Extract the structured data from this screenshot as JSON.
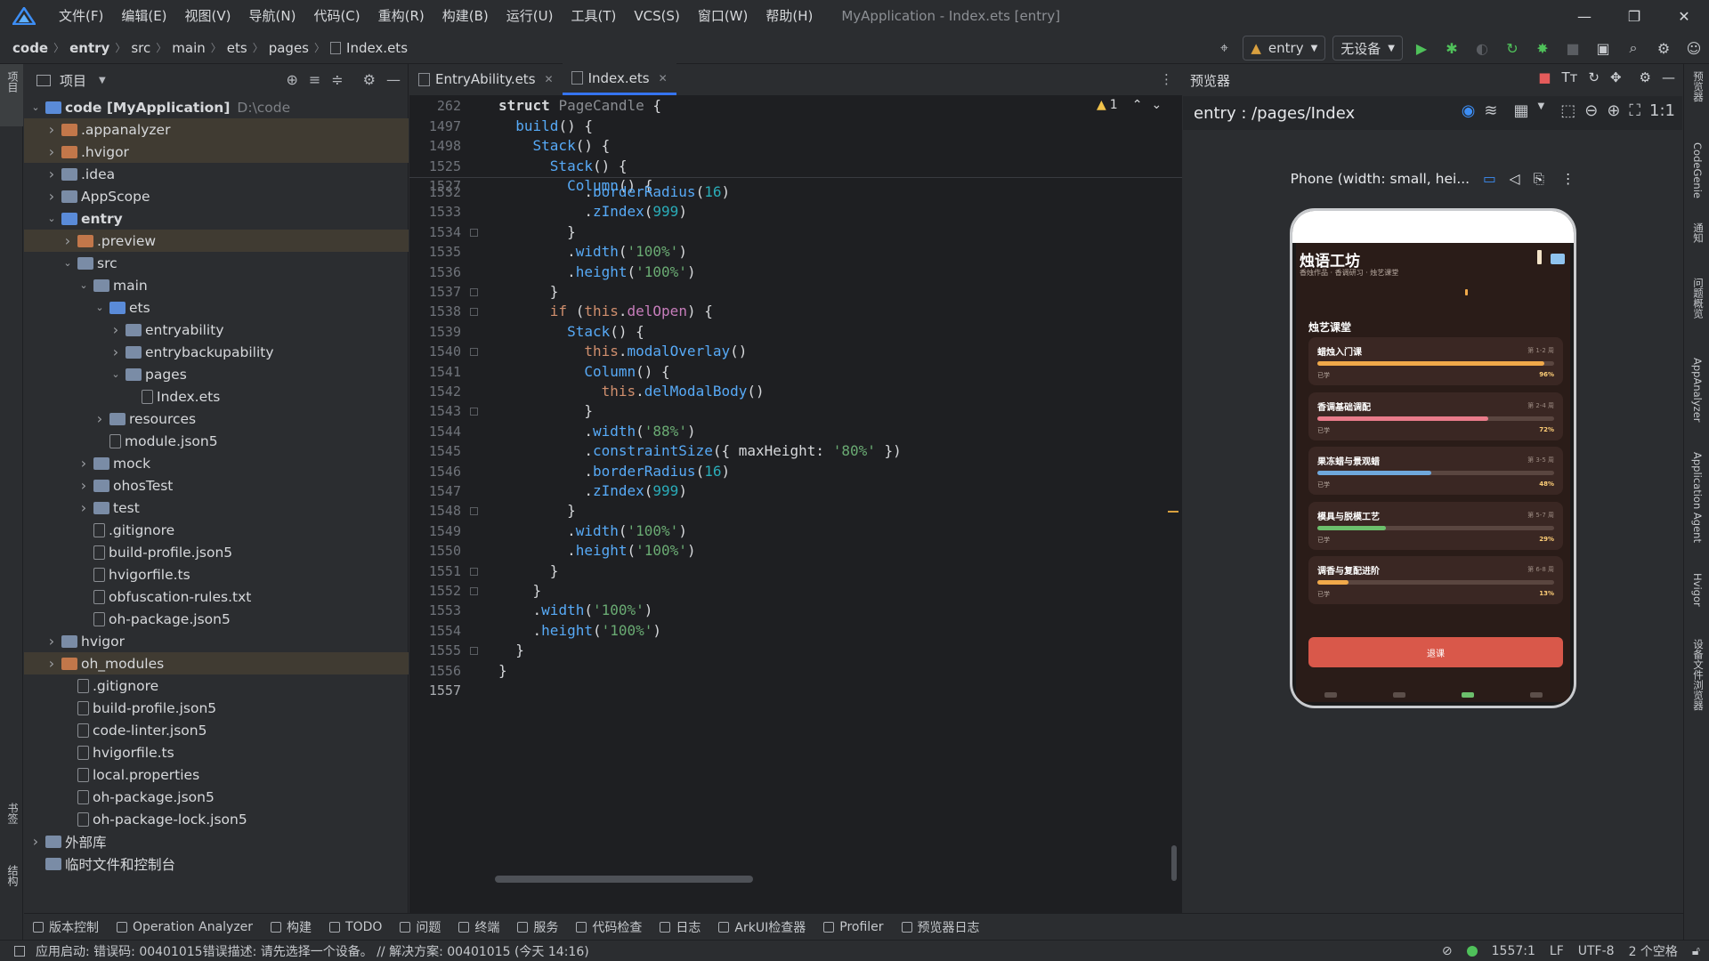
{
  "window": {
    "title": "MyApplication - Index.ets [entry]",
    "menu": [
      "文件(F)",
      "编辑(E)",
      "视图(V)",
      "导航(N)",
      "代码(C)",
      "重构(R)",
      "构建(B)",
      "运行(U)",
      "工具(T)",
      "VCS(S)",
      "窗口(W)",
      "帮助(H)"
    ]
  },
  "breadcrumb": [
    "code",
    "entry",
    "src",
    "main",
    "ets",
    "pages",
    "Index.ets"
  ],
  "toolbar": {
    "module": "entry",
    "device": "无设备"
  },
  "left_stripe": {
    "project_label": "项目",
    "bookmarks_label": "书签",
    "structure_label": "结构"
  },
  "project_panel": {
    "title": "项目",
    "tree": [
      {
        "label": "code [MyApplication]",
        "path": "D:\\code",
        "depth": 0,
        "arrow": "open",
        "icon": "folder-blue",
        "bold": true
      },
      {
        "label": ".appanalyzer",
        "depth": 1,
        "arrow": "closed",
        "icon": "folder-orange",
        "hl": true
      },
      {
        "label": ".hvigor",
        "depth": 1,
        "arrow": "closed",
        "icon": "folder-orange",
        "hl": true
      },
      {
        "label": ".idea",
        "depth": 1,
        "arrow": "closed",
        "icon": "folder"
      },
      {
        "label": "AppScope",
        "depth": 1,
        "arrow": "closed",
        "icon": "folder"
      },
      {
        "label": "entry",
        "depth": 1,
        "arrow": "open",
        "icon": "folder-blue",
        "bold": true
      },
      {
        "label": ".preview",
        "depth": 2,
        "arrow": "closed",
        "icon": "folder-orange",
        "hl": true
      },
      {
        "label": "src",
        "depth": 2,
        "arrow": "open",
        "icon": "folder"
      },
      {
        "label": "main",
        "depth": 3,
        "arrow": "open",
        "icon": "folder"
      },
      {
        "label": "ets",
        "depth": 4,
        "arrow": "open",
        "icon": "folder-blue"
      },
      {
        "label": "entryability",
        "depth": 5,
        "arrow": "closed",
        "icon": "folder"
      },
      {
        "label": "entrybackupability",
        "depth": 5,
        "arrow": "closed",
        "icon": "folder"
      },
      {
        "label": "pages",
        "depth": 5,
        "arrow": "open",
        "icon": "folder"
      },
      {
        "label": "Index.ets",
        "depth": 6,
        "arrow": "",
        "icon": "file"
      },
      {
        "label": "resources",
        "depth": 4,
        "arrow": "closed",
        "icon": "folder"
      },
      {
        "label": "module.json5",
        "depth": 4,
        "arrow": "",
        "icon": "file"
      },
      {
        "label": "mock",
        "depth": 3,
        "arrow": "closed",
        "icon": "folder"
      },
      {
        "label": "ohosTest",
        "depth": 3,
        "arrow": "closed",
        "icon": "folder"
      },
      {
        "label": "test",
        "depth": 3,
        "arrow": "closed",
        "icon": "folder"
      },
      {
        "label": ".gitignore",
        "depth": 3,
        "arrow": "",
        "icon": "file"
      },
      {
        "label": "build-profile.json5",
        "depth": 3,
        "arrow": "",
        "icon": "file"
      },
      {
        "label": "hvigorfile.ts",
        "depth": 3,
        "arrow": "",
        "icon": "file"
      },
      {
        "label": "obfuscation-rules.txt",
        "depth": 3,
        "arrow": "",
        "icon": "file"
      },
      {
        "label": "oh-package.json5",
        "depth": 3,
        "arrow": "",
        "icon": "file"
      },
      {
        "label": "hvigor",
        "depth": 1,
        "arrow": "closed",
        "icon": "folder"
      },
      {
        "label": "oh_modules",
        "depth": 1,
        "arrow": "closed",
        "icon": "folder-orange",
        "hl": true
      },
      {
        "label": ".gitignore",
        "depth": 2,
        "arrow": "",
        "icon": "file"
      },
      {
        "label": "build-profile.json5",
        "depth": 2,
        "arrow": "",
        "icon": "file"
      },
      {
        "label": "code-linter.json5",
        "depth": 2,
        "arrow": "",
        "icon": "file"
      },
      {
        "label": "hvigorfile.ts",
        "depth": 2,
        "arrow": "",
        "icon": "file"
      },
      {
        "label": "local.properties",
        "depth": 2,
        "arrow": "",
        "icon": "file"
      },
      {
        "label": "oh-package.json5",
        "depth": 2,
        "arrow": "",
        "icon": "file"
      },
      {
        "label": "oh-package-lock.json5",
        "depth": 2,
        "arrow": "",
        "icon": "file"
      },
      {
        "label": "外部库",
        "depth": 0,
        "arrow": "closed",
        "icon": "library"
      },
      {
        "label": "临时文件和控制台",
        "depth": 0,
        "arrow": "",
        "icon": "scratch"
      }
    ]
  },
  "editor": {
    "tabs": [
      {
        "label": "EntryAbility.ets",
        "active": false
      },
      {
        "label": "Index.ets",
        "active": true
      }
    ],
    "warning_count": "1",
    "sticky": [
      {
        "ln": "262",
        "code": [
          [
            "kw2",
            "struct "
          ],
          [
            "typ",
            "PageCandle "
          ],
          [
            "dim",
            "{"
          ]
        ]
      },
      {
        "ln": "1497",
        "code": [
          [
            "dim",
            "  "
          ],
          [
            "call",
            "build"
          ],
          [
            "dim",
            "() {"
          ]
        ]
      },
      {
        "ln": "1498",
        "code": [
          [
            "dim",
            "    "
          ],
          [
            "call",
            "Stack"
          ],
          [
            "dim",
            "() {"
          ]
        ]
      },
      {
        "ln": "1525",
        "code": [
          [
            "dim",
            "      "
          ],
          [
            "call",
            "Stack"
          ],
          [
            "dim",
            "() {"
          ]
        ]
      },
      {
        "ln": "1527",
        "code": [
          [
            "dim",
            "        "
          ],
          [
            "call",
            "Column"
          ],
          [
            "dim",
            "() {"
          ]
        ]
      }
    ],
    "lines": [
      {
        "ln": "1532",
        "code": [
          [
            "dim",
            "          ."
          ],
          [
            "call",
            "borderRadius"
          ],
          [
            "dim",
            "("
          ],
          [
            "num",
            "16"
          ],
          [
            "dim",
            ")"
          ]
        ]
      },
      {
        "ln": "1533",
        "code": [
          [
            "dim",
            "          ."
          ],
          [
            "call",
            "zIndex"
          ],
          [
            "dim",
            "("
          ],
          [
            "num",
            "999"
          ],
          [
            "dim",
            ")"
          ]
        ]
      },
      {
        "ln": "1534",
        "code": [
          [
            "dim",
            "        }"
          ]
        ]
      },
      {
        "ln": "1535",
        "code": [
          [
            "dim",
            "        ."
          ],
          [
            "call",
            "width"
          ],
          [
            "dim",
            "("
          ],
          [
            "str",
            "'100%'"
          ],
          [
            "dim",
            ")"
          ]
        ]
      },
      {
        "ln": "1536",
        "code": [
          [
            "dim",
            "        ."
          ],
          [
            "call",
            "height"
          ],
          [
            "dim",
            "("
          ],
          [
            "str",
            "'100%'"
          ],
          [
            "dim",
            ")"
          ]
        ]
      },
      {
        "ln": "1537",
        "code": [
          [
            "dim",
            "      }"
          ]
        ]
      },
      {
        "ln": "1538",
        "code": [
          [
            "dim",
            "      "
          ],
          [
            "kw",
            "if "
          ],
          [
            "dim",
            "("
          ],
          [
            "kw",
            "this"
          ],
          [
            "dim",
            "."
          ],
          [
            "prop",
            "delOpen"
          ],
          [
            "dim",
            ") {"
          ]
        ]
      },
      {
        "ln": "1539",
        "code": [
          [
            "dim",
            "        "
          ],
          [
            "call",
            "Stack"
          ],
          [
            "dim",
            "() {"
          ]
        ]
      },
      {
        "ln": "1540",
        "code": [
          [
            "dim",
            "          "
          ],
          [
            "kw",
            "this"
          ],
          [
            "dim",
            "."
          ],
          [
            "call",
            "modalOverlay"
          ],
          [
            "dim",
            "()"
          ]
        ]
      },
      {
        "ln": "1541",
        "code": [
          [
            "dim",
            "          "
          ],
          [
            "call",
            "Column"
          ],
          [
            "dim",
            "() {"
          ]
        ]
      },
      {
        "ln": "1542",
        "code": [
          [
            "dim",
            "            "
          ],
          [
            "kw",
            "this"
          ],
          [
            "dim",
            "."
          ],
          [
            "call",
            "delModalBody"
          ],
          [
            "dim",
            "()"
          ]
        ]
      },
      {
        "ln": "1543",
        "code": [
          [
            "dim",
            "          }"
          ]
        ]
      },
      {
        "ln": "1544",
        "code": [
          [
            "dim",
            "          ."
          ],
          [
            "call",
            "width"
          ],
          [
            "dim",
            "("
          ],
          [
            "str",
            "'88%'"
          ],
          [
            "dim",
            ")"
          ]
        ]
      },
      {
        "ln": "1545",
        "code": [
          [
            "dim",
            "          ."
          ],
          [
            "call",
            "constraintSize"
          ],
          [
            "dim",
            "({ maxHeight: "
          ],
          [
            "str",
            "'80%'"
          ],
          [
            "dim",
            " })"
          ]
        ]
      },
      {
        "ln": "1546",
        "code": [
          [
            "dim",
            "          ."
          ],
          [
            "call",
            "borderRadius"
          ],
          [
            "dim",
            "("
          ],
          [
            "num",
            "16"
          ],
          [
            "dim",
            ")"
          ]
        ]
      },
      {
        "ln": "1547",
        "code": [
          [
            "dim",
            "          ."
          ],
          [
            "call",
            "zIndex"
          ],
          [
            "dim",
            "("
          ],
          [
            "num",
            "999"
          ],
          [
            "dim",
            ")"
          ]
        ]
      },
      {
        "ln": "1548",
        "code": [
          [
            "dim",
            "        }"
          ]
        ]
      },
      {
        "ln": "1549",
        "code": [
          [
            "dim",
            "        ."
          ],
          [
            "call",
            "width"
          ],
          [
            "dim",
            "("
          ],
          [
            "str",
            "'100%'"
          ],
          [
            "dim",
            ")"
          ]
        ]
      },
      {
        "ln": "1550",
        "code": [
          [
            "dim",
            "        ."
          ],
          [
            "call",
            "height"
          ],
          [
            "dim",
            "("
          ],
          [
            "str",
            "'100%'"
          ],
          [
            "dim",
            ")"
          ]
        ]
      },
      {
        "ln": "1551",
        "code": [
          [
            "dim",
            "      }"
          ]
        ]
      },
      {
        "ln": "1552",
        "code": [
          [
            "dim",
            "    }"
          ]
        ]
      },
      {
        "ln": "1553",
        "code": [
          [
            "dim",
            "    ."
          ],
          [
            "call",
            "width"
          ],
          [
            "dim",
            "("
          ],
          [
            "str",
            "'100%'"
          ],
          [
            "dim",
            ")"
          ]
        ]
      },
      {
        "ln": "1554",
        "code": [
          [
            "dim",
            "    ."
          ],
          [
            "call",
            "height"
          ],
          [
            "dim",
            "("
          ],
          [
            "str",
            "'100%'"
          ],
          [
            "dim",
            ")"
          ]
        ]
      },
      {
        "ln": "1555",
        "code": [
          [
            "dim",
            "  }"
          ]
        ]
      },
      {
        "ln": "1556",
        "code": [
          [
            "dim",
            "}"
          ]
        ]
      },
      {
        "ln": "1557",
        "code": []
      }
    ]
  },
  "previewer": {
    "title": "预览器",
    "route": "entry : /pages/Index",
    "device": "Phone (width: small, hei...",
    "app": {
      "title": "烛语工坊",
      "subtitle": "香烛作品 · 香调研习 · 烛艺课堂",
      "section": "烛艺课堂",
      "courses": [
        {
          "name": "蜡烛入门课",
          "week": "第 1-2 周",
          "label": "已学",
          "pct": "96%",
          "value": 0.96,
          "color": "#f0a94a"
        },
        {
          "name": "香调基础调配",
          "week": "第 2-4 周",
          "label": "已学",
          "pct": "72%",
          "value": 0.72,
          "color": "#e97b8a"
        },
        {
          "name": "果冻蜡与景观蜡",
          "week": "第 3-5 周",
          "label": "已学",
          "pct": "48%",
          "value": 0.48,
          "color": "#6fa8dc"
        },
        {
          "name": "模具与脱模工艺",
          "week": "第 5-7 周",
          "label": "已学",
          "pct": "29%",
          "value": 0.29,
          "color": "#6cbf6c"
        },
        {
          "name": "调香与复配进阶",
          "week": "第 6-8 周",
          "label": "已学",
          "pct": "13%",
          "value": 0.13,
          "color": "#f0a94a"
        }
      ],
      "exit_button": "退课"
    }
  },
  "right_stripe": [
    "预览器",
    "CodeGenie",
    "通知",
    "问题概览",
    "AppAnalyzer",
    "Application Agent",
    "Hvigor",
    "设备文件浏览器"
  ],
  "bottom_tools": [
    "版本控制",
    "Operation Analyzer",
    "构建",
    "TODO",
    "问题",
    "终端",
    "服务",
    "代码检查",
    "日志",
    "ArkUI检查器",
    "Profiler",
    "预览器日志"
  ],
  "status": {
    "message": "应用启动: 错误码: 00401015错误描述: 请先选择一个设备。 // 解决方案: 00401015 (今天 14:16)",
    "position": "1557:1",
    "line_ending": "LF",
    "encoding": "UTF-8",
    "indent": "2 个空格"
  }
}
